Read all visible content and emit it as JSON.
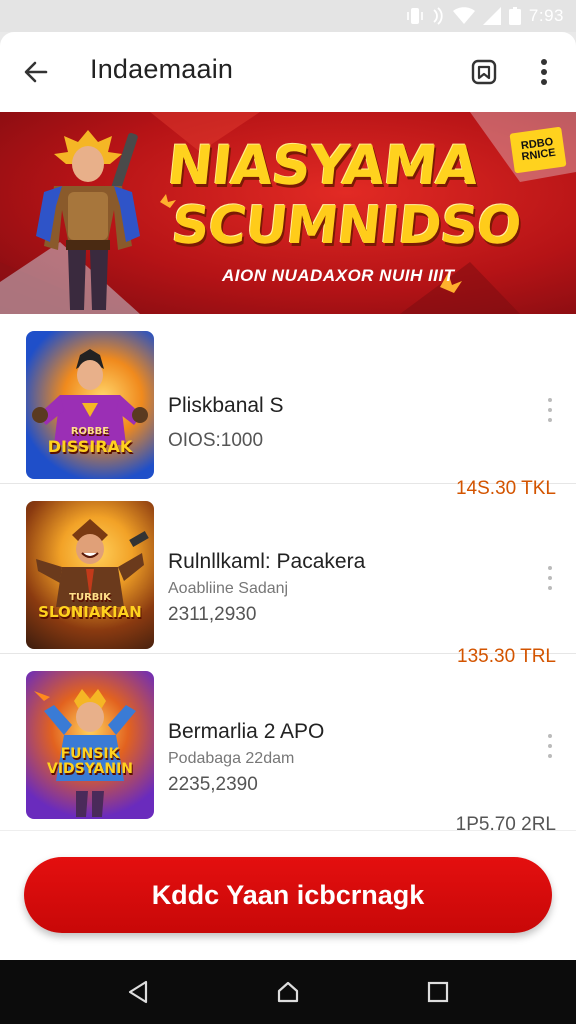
{
  "status_bar": {
    "time": "7:93",
    "icons": [
      "vibrate-icon",
      "nfc-icon",
      "wifi-icon",
      "signal-icon",
      "battery-icon"
    ]
  },
  "toolbar": {
    "title": "Indaemaain",
    "icons": [
      "back-arrow-icon",
      "bookmark-icon",
      "more-vertical-icon"
    ]
  },
  "banner": {
    "title_line1": "NIASYAMA",
    "title_line2": "SCUMNIDSO",
    "subtitle": "AION NUADAXOR NUIH IIIT",
    "badge": "RDBO RNICE"
  },
  "items": [
    {
      "title": "Pliskbanal S",
      "subtitle": "",
      "code": "OIOS:1000",
      "price": "14S.30 TKL",
      "thumb_label": "DISSIRAK",
      "thumb_top_label": "ROBBE",
      "colors": {
        "bg_from": "#1f4fc9",
        "bg_to": "#f08a1d",
        "figure": "#9b2fb5"
      }
    },
    {
      "title": "Rulnllkaml: Pacakera",
      "subtitle": "Aoabliine Sadanj",
      "code": "2311,2930",
      "price": "135.30 TRL",
      "thumb_label": "SLONIAKIAN",
      "thumb_top_label": "TURBIK",
      "colors": {
        "bg_from": "#f2a227",
        "bg_to": "#3b1c0e",
        "figure": "#6b3a1c"
      }
    },
    {
      "title": "Bermarlia 2 APO",
      "subtitle": "Podabaga 22dam",
      "code": "2235,2390",
      "price": "1P5,70 2RL",
      "thumb_label": "FUNSIK VIDSYANIN",
      "thumb_top_label": "",
      "colors": {
        "bg_from": "#6a2bbd",
        "bg_to": "#e2621f",
        "figure": "#3a7bd5"
      }
    }
  ],
  "cta": {
    "label": "Kddc Yaan icbcrnagk"
  },
  "nav": {
    "icons": [
      "back-triangle-icon",
      "home-circle-icon",
      "recents-square-icon"
    ]
  },
  "colors": {
    "accent": "#d40c0c",
    "price": "#d35400",
    "banner_red": "#c4161a",
    "title_gold": "#ffd21e"
  }
}
